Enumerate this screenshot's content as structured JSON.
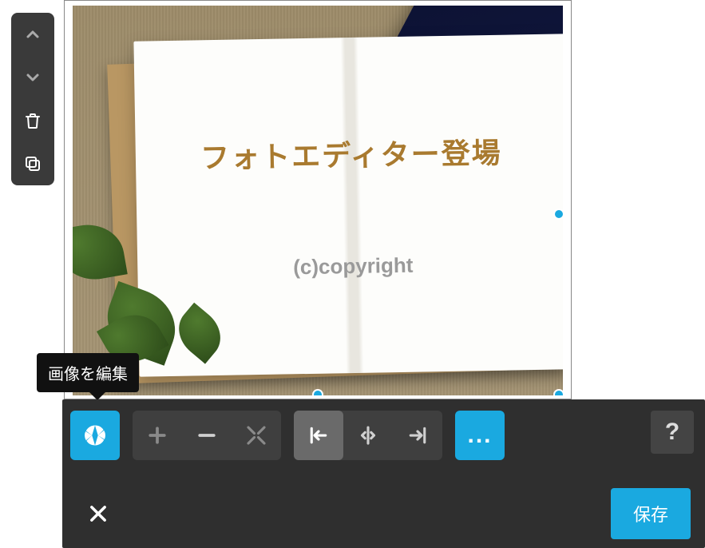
{
  "sidebar": {
    "items": [
      {
        "name": "move-up",
        "icon": "chevron-up"
      },
      {
        "name": "move-down",
        "icon": "chevron-down"
      },
      {
        "name": "delete",
        "icon": "trash"
      },
      {
        "name": "duplicate",
        "icon": "copy"
      }
    ]
  },
  "canvas": {
    "title_text": "フォトエディター登場",
    "copyright_text": "(c)copyright",
    "handle_color": "#1aa9e0"
  },
  "tooltip": {
    "text": "画像を編集"
  },
  "toolbar": {
    "edit_image": {
      "name": "edit-image",
      "active": true
    },
    "transform_group": [
      {
        "name": "add",
        "icon": "plus"
      },
      {
        "name": "subtract",
        "icon": "minus"
      },
      {
        "name": "expand",
        "icon": "expand"
      }
    ],
    "align_group": [
      {
        "name": "align-left",
        "icon": "align-left",
        "active": true
      },
      {
        "name": "align-center",
        "icon": "align-center"
      },
      {
        "name": "align-right",
        "icon": "align-right"
      }
    ],
    "more": {
      "name": "more",
      "label": "..."
    },
    "help": {
      "label": "?"
    }
  },
  "actions": {
    "close": {
      "name": "close"
    },
    "save": {
      "label": "保存"
    }
  },
  "colors": {
    "accent": "#1aa9e0",
    "panel": "#2f2f2f",
    "panel_light": "#3f3f3f"
  }
}
